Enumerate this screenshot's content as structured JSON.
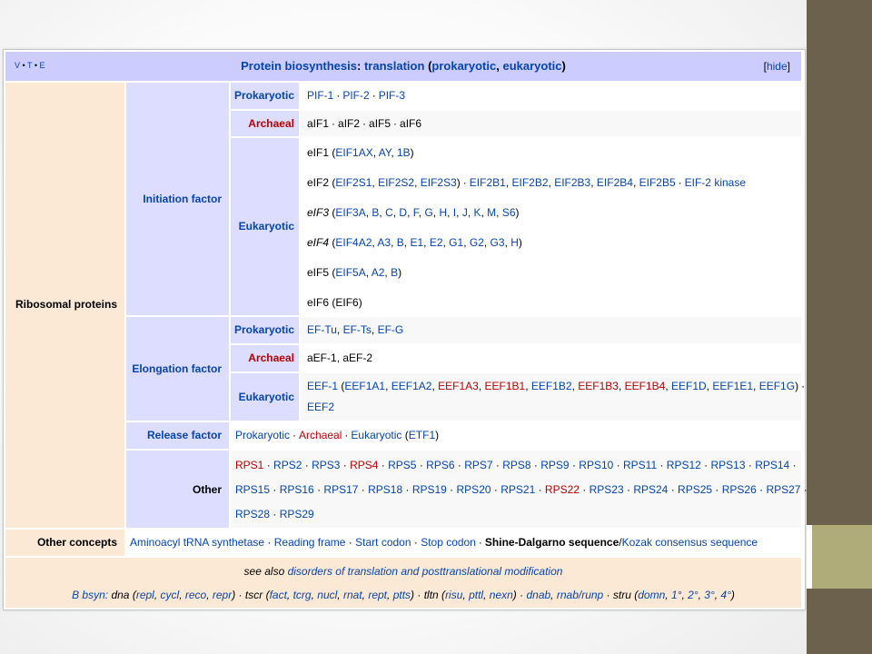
{
  "navbox": {
    "vte": {
      "v": "V",
      "t": "T",
      "e": "E"
    },
    "title": {
      "main": "Protein biosynthesis",
      "colon": ":",
      "sub": "translation",
      "paren_open": "(",
      "prok": "prokaryotic",
      "comma": ",",
      "euk": "eukaryotic",
      "paren_close": ")"
    },
    "hide": {
      "open": "[",
      "label": "hide",
      "close": "]"
    },
    "ribosomal_proteins": "Ribosomal proteins",
    "initiation": {
      "label": "Initiation factor",
      "prokaryotic": {
        "label": "Prokaryotic",
        "items": [
          "PIF-1",
          "PIF-2",
          "PIF-3"
        ]
      },
      "archaeal": {
        "label": "Archaeal",
        "items": [
          "aIF1",
          "aIF2",
          "aIF5",
          "aIF6"
        ]
      },
      "eukaryotic": {
        "label": "Eukaryotic",
        "eif1": {
          "name": "eIF1",
          "open": " (",
          "items": [
            "EIF1AX",
            "AY",
            "1B"
          ],
          "close": ")"
        },
        "eif2": {
          "name": "eIF2",
          "open": " (",
          "items": [
            "EIF2S1",
            "EIF2S2",
            "EIF2S3"
          ],
          "close": ")",
          "extra": [
            "EIF2B1",
            "EIF2B2",
            "EIF2B3",
            "EIF2B4",
            "EIF2B5",
            "EIF-2 kinase"
          ]
        },
        "eif3": {
          "name": "eIF3",
          "open": " (",
          "items": [
            "EIF3A",
            "B",
            "C",
            "D",
            "F",
            "G",
            "H",
            "I",
            "J",
            "K",
            "M",
            "S6"
          ],
          "close": ")"
        },
        "eif4": {
          "name": "eIF4",
          "open": " (",
          "items": [
            "EIF4A2",
            "A3",
            "B",
            "E1",
            "E2",
            "G1",
            "G2",
            "G3",
            "H"
          ],
          "close": ")"
        },
        "eif5": {
          "name": "eIF5",
          "open": " (",
          "items": [
            "EIF5A",
            "A2",
            "B"
          ],
          "close": ")"
        },
        "eif6": {
          "name": "eIF6",
          "open": " (",
          "items": [
            "EIF6"
          ],
          "close": ")"
        }
      }
    },
    "elongation": {
      "label": "Elongation factor",
      "prokaryotic": {
        "label": "Prokaryotic",
        "items": [
          "EF-Tu",
          "EF-Ts",
          "EF-G"
        ]
      },
      "archaeal": {
        "label": "Archaeal",
        "items": [
          "aEF-1",
          "aEF-2"
        ]
      },
      "eukaryotic": {
        "label": "Eukaryotic",
        "name": "EEF-1",
        "open": " (",
        "items": [
          {
            "t": "EEF1A1",
            "c": "lnk"
          },
          {
            "t": "EEF1A2",
            "c": "lnk"
          },
          {
            "t": "EEF1A3",
            "c": "red"
          },
          {
            "t": "EEF1B1",
            "c": "red"
          },
          {
            "t": "EEF1B2",
            "c": "lnk"
          },
          {
            "t": "EEF1B3",
            "c": "red"
          },
          {
            "t": "EEF1B4",
            "c": "red"
          },
          {
            "t": "EEF1D",
            "c": "lnk"
          },
          {
            "t": "EEF1E1",
            "c": "lnk"
          },
          {
            "t": "EEF1G",
            "c": "lnk"
          }
        ],
        "close": ")",
        "line2": "EEF2"
      }
    },
    "release": {
      "label": "Release factor",
      "prok": "Prokaryotic",
      "arch": "Archaeal",
      "euk": "Eukaryotic",
      "euk_open": " (",
      "euk_item": "ETF1",
      "euk_close": ")"
    },
    "other": {
      "label": "Other",
      "line1": [
        {
          "t": "RPS1",
          "c": "red"
        },
        {
          "t": "RPS2",
          "c": "lnk"
        },
        {
          "t": "RPS3",
          "c": "lnk"
        },
        {
          "t": "RPS4",
          "c": "red"
        },
        {
          "t": "RPS5",
          "c": "lnk"
        },
        {
          "t": "RPS6",
          "c": "lnk"
        },
        {
          "t": "RPS7",
          "c": "lnk"
        },
        {
          "t": "RPS8",
          "c": "lnk"
        },
        {
          "t": "RPS9",
          "c": "lnk"
        },
        {
          "t": "RPS10",
          "c": "lnk"
        },
        {
          "t": "RPS11",
          "c": "lnk"
        },
        {
          "t": "RPS12",
          "c": "lnk"
        },
        {
          "t": "RPS13",
          "c": "lnk"
        },
        {
          "t": "RPS14",
          "c": "lnk"
        }
      ],
      "line2": [
        {
          "t": "RPS15",
          "c": "lnk"
        },
        {
          "t": "RPS16",
          "c": "lnk"
        },
        {
          "t": "RPS17",
          "c": "lnk"
        },
        {
          "t": "RPS18",
          "c": "lnk"
        },
        {
          "t": "RPS19",
          "c": "lnk"
        },
        {
          "t": "RPS20",
          "c": "lnk"
        },
        {
          "t": "RPS21",
          "c": "lnk"
        },
        {
          "t": "RPS22",
          "c": "red"
        },
        {
          "t": "RPS23",
          "c": "lnk"
        },
        {
          "t": "RPS24",
          "c": "lnk"
        },
        {
          "t": "RPS25",
          "c": "lnk"
        },
        {
          "t": "RPS26",
          "c": "lnk"
        },
        {
          "t": "RPS27",
          "c": "lnk"
        }
      ],
      "line3": [
        {
          "t": "RPS28",
          "c": "lnk"
        },
        {
          "t": "RPS29",
          "c": "lnk"
        }
      ]
    },
    "other_concepts": {
      "label": "Other concepts",
      "items": [
        {
          "t": "Aminoacyl tRNA synthetase",
          "c": "lnk"
        },
        {
          "t": "Reading frame",
          "c": "lnk"
        },
        {
          "t": "Start codon",
          "c": "lnk"
        },
        {
          "t": "Stop codon",
          "c": "lnk"
        }
      ],
      "bold": "Shine-Dalgarno sequence",
      "slash": "/",
      "kozak": "Kozak consensus sequence"
    },
    "see_also": {
      "prefix": "see also",
      "link": "disorders of translation and posttranslational modification"
    },
    "bsyn": {
      "prefix": "B bsyn:",
      "dna": "dna",
      "dna_items": [
        "repl",
        "cycl",
        "reco",
        "repr"
      ],
      "tscr": "tscr",
      "tscr_items": [
        "fact",
        "tcrg",
        "nucl",
        "rnat",
        "rept",
        "ptts"
      ],
      "tltn": "tltn",
      "tltn_items": [
        "risu",
        "pttl",
        "nexn"
      ],
      "dnab": "dnab",
      "rnab": "rnab/runp",
      "stru": "stru",
      "stru_items": [
        "domn",
        "1°",
        "2°",
        "3°",
        "4°"
      ]
    }
  },
  "colors": {
    "link": "#0645ad",
    "redlink": "#ba0000",
    "title_bg": "#ccccff",
    "group_bg": "#ddddff",
    "footer_bg": "#fbe9d6",
    "side_panel": "#6b614c",
    "side_accent": "#b0ac7a"
  }
}
